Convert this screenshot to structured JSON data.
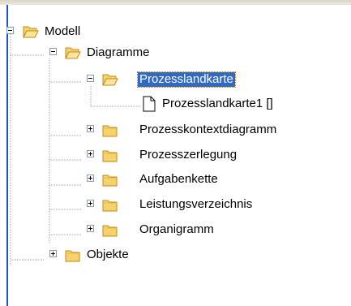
{
  "tree": {
    "root": {
      "label": "Modell",
      "expanded": true,
      "icon": "folder-open-icon",
      "children": [
        {
          "label": "Diagramme",
          "expanded": true,
          "icon": "folder-open-icon",
          "children": [
            {
              "label": "Prozesslandkarte",
              "expanded": true,
              "selected": true,
              "icon": "folder-open-icon",
              "children": [
                {
                  "label": "Prozesslandkarte1 []",
                  "icon": "document-icon"
                }
              ]
            },
            {
              "label": "Prozesskontextdiagramm",
              "expanded": false,
              "icon": "folder-icon"
            },
            {
              "label": "Prozesszerlegung",
              "expanded": false,
              "icon": "folder-icon"
            },
            {
              "label": "Aufgabenkette",
              "expanded": false,
              "icon": "folder-icon"
            },
            {
              "label": "Leistungsverzeichnis",
              "expanded": false,
              "icon": "folder-icon"
            },
            {
              "label": "Organigramm",
              "expanded": false,
              "icon": "folder-icon"
            }
          ]
        },
        {
          "label": "Objekte",
          "expanded": false,
          "icon": "folder-icon"
        }
      ]
    }
  },
  "colors": {
    "selection": "#316ac5",
    "folder_fill": "#f6d36a",
    "folder_stroke": "#c08a18"
  }
}
